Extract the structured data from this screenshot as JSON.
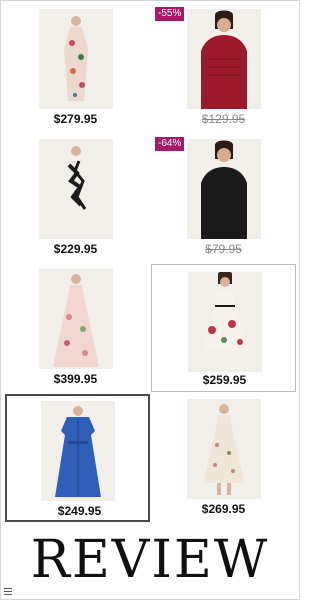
{
  "products": [
    {
      "price": "$279.95",
      "strike": false,
      "badge": "",
      "dress": "floral-maxi-dress",
      "color": "#e8d2c5",
      "accent": "#c64a63"
    },
    {
      "price": "$129.95",
      "strike": true,
      "badge": "-55%",
      "dress": "red-lace-top",
      "color": "#9b1b2a",
      "accent": "#7a1320"
    },
    {
      "price": "$229.95",
      "strike": false,
      "badge": "",
      "dress": "black-white-print-dress",
      "color": "#e9e6e0",
      "accent": "#1b1b1b"
    },
    {
      "price": "$79.95",
      "strike": true,
      "badge": "-64%",
      "dress": "black-knit-top",
      "color": "#1a1a1a",
      "accent": "#111111"
    },
    {
      "price": "$399.95",
      "strike": false,
      "badge": "",
      "dress": "pink-floral-gown",
      "color": "#f1d7cf",
      "accent": "#d88a8a"
    },
    {
      "price": "$259.95",
      "strike": false,
      "badge": "",
      "dress": "white-rose-midi-dress",
      "color": "#f4eee6",
      "accent": "#c2344b"
    },
    {
      "price": "$249.95",
      "strike": false,
      "badge": "",
      "dress": "blue-shirt-dress",
      "color": "#2f5fb8",
      "accent": "#234a93"
    },
    {
      "price": "$269.95",
      "strike": false,
      "badge": "",
      "dress": "cream-floral-sundress",
      "color": "#efe6d8",
      "accent": "#b98a7a"
    }
  ],
  "footer": {
    "review_label": "REVIEW",
    "menu_icon": "hamburger-menu-icon"
  }
}
